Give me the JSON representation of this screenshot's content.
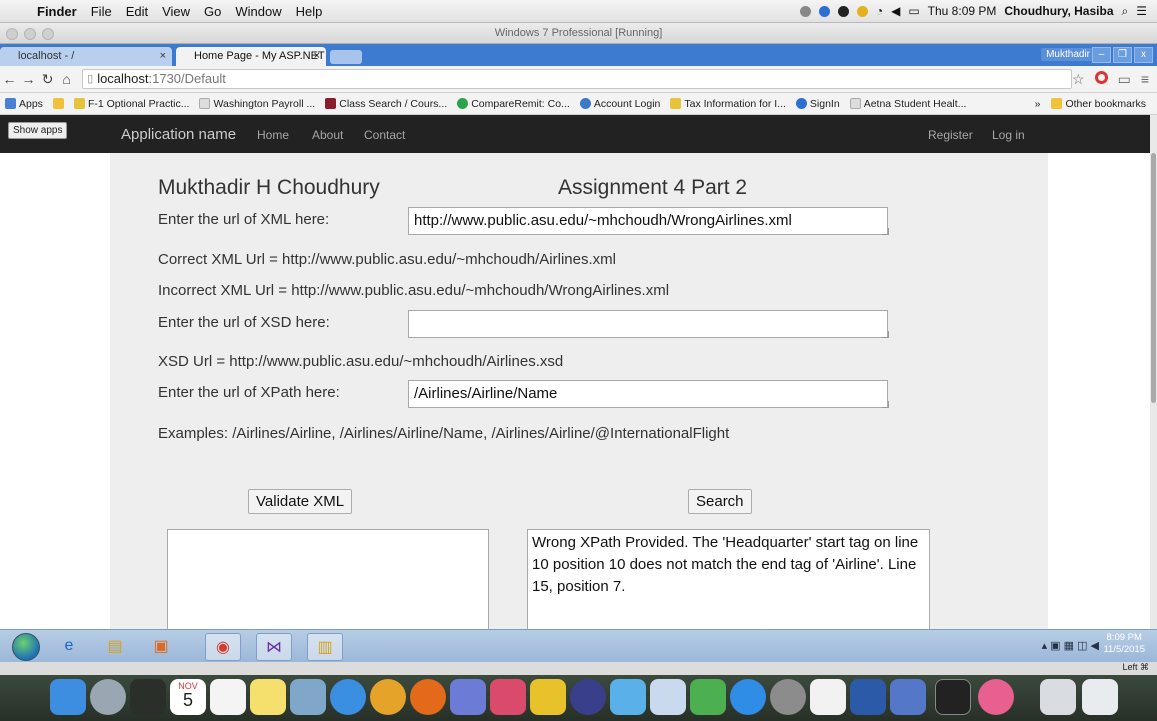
{
  "menubar": {
    "app": "Finder",
    "items": [
      "File",
      "Edit",
      "View",
      "Go",
      "Window",
      "Help"
    ],
    "clock": "Thu 8:09 PM",
    "user": "Choudhury, Hasiba"
  },
  "vm_title": "Windows 7 Professional [Running]",
  "tabs": [
    {
      "label": "localhost - /"
    },
    {
      "label": "Home Page - My ASP.NET"
    }
  ],
  "tab_user": "Mukthadir",
  "address": {
    "host": "localhost",
    "path": ":1730/Default"
  },
  "bookmarks": [
    {
      "label": "Apps",
      "color": "#4a7fd6"
    },
    {
      "label": "F-1 Optional Practic...",
      "color": "#e8c33a"
    },
    {
      "label": "Washington Payroll ...",
      "color": "#cccccc"
    },
    {
      "label": "Class Search / Cours...",
      "color": "#8a1d2b"
    },
    {
      "label": "CompareRemit: Co...",
      "color": "#2aa34a"
    },
    {
      "label": "Account Login",
      "color": "#3a78c8"
    },
    {
      "label": "Tax Information for I...",
      "color": "#e8c33a"
    },
    {
      "label": "SignIn",
      "color": "#2f6fd0"
    },
    {
      "label": "Aetna Student Healt...",
      "color": "#cccccc"
    }
  ],
  "bookmarks_more": "»",
  "bookmarks_other": "Other bookmarks",
  "site": {
    "show_apps": "Show apps",
    "brand": "Application name",
    "nav": [
      "Home",
      "About",
      "Contact"
    ],
    "register": "Register",
    "login": "Log in"
  },
  "form": {
    "name": "Mukthadir H Choudhury",
    "assignment": "Assignment 4 Part 2",
    "xml_label": "Enter the url of XML here:",
    "xml_value": "http://www.public.asu.edu/~mhchoudh/WrongAirlines.xml",
    "correct_xml": "Correct XML Url = http://www.public.asu.edu/~mhchoudh/Airlines.xml",
    "incorrect_xml": "Incorrect XML Url = http://www.public.asu.edu/~mhchoudh/WrongAirlines.xml",
    "xsd_label": "Enter the url of XSD here:",
    "xsd_value": "",
    "xsd_url": "XSD Url = http://www.public.asu.edu/~mhchoudh/Airlines.xsd",
    "xpath_label": "Enter the url of XPath here:",
    "xpath_value": "/Airlines/Airline/Name",
    "examples": "Examples: /Airlines/Airline, /Airlines/Airline/Name, /Airlines/Airline/@InternationalFlight",
    "validate_button": "Validate XML",
    "search_button": "Search",
    "validate_output": "",
    "search_output": "Wrong XPath Provided. The 'Headquarter' start tag on line 10 position 10 does not match the end tag of 'Airline'. Line 15, position 7."
  },
  "taskbar": {
    "time": "8:09 PM",
    "date": "11/5/2015"
  },
  "vmstrip_right": "Left ⌘",
  "dock_calendar_day": "5",
  "dock_calendar_month": "NOV"
}
